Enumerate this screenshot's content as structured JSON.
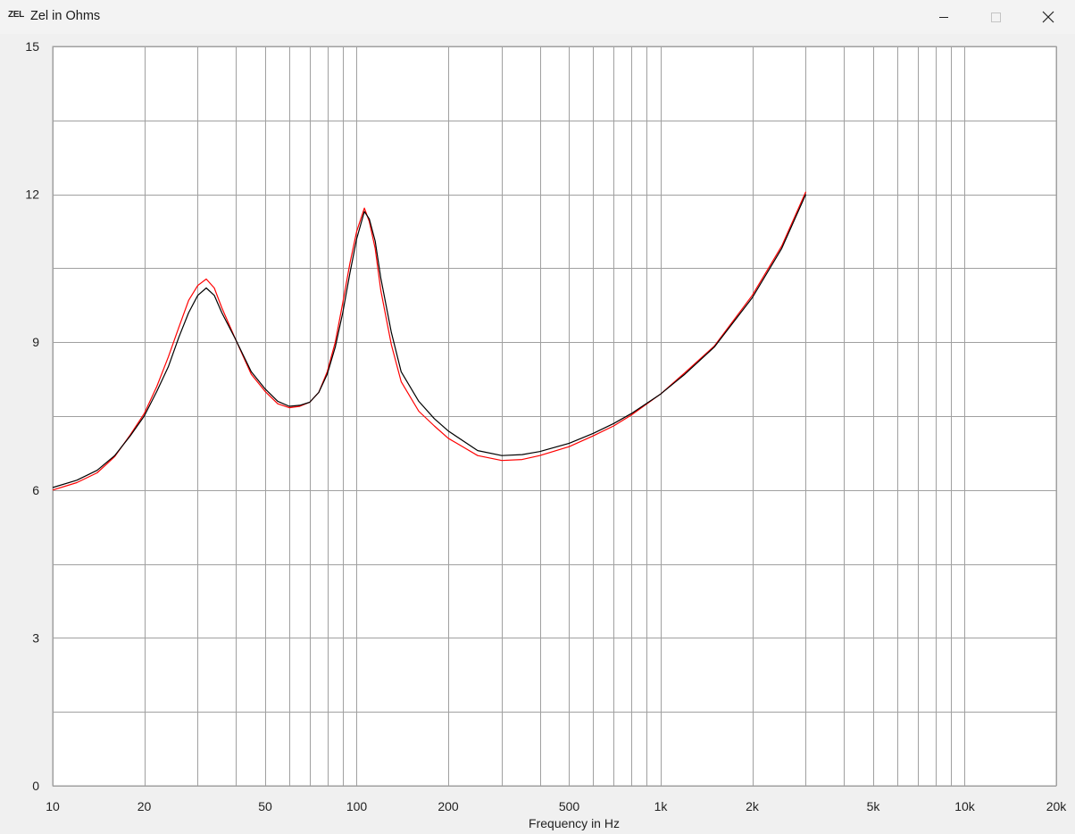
{
  "window": {
    "app_icon_text": "ZEL",
    "title": "Zel in Ohms",
    "minimize_icon": "minimize-icon",
    "maximize_icon": "maximize-icon",
    "close_icon": "close-icon"
  },
  "colors": {
    "background": "#f0f0f0",
    "plot_background": "#ffffff",
    "grid": "#a0a0a0",
    "series_measured": "#000000",
    "series_simulated": "#ff0000"
  },
  "chart_data": {
    "type": "line",
    "title": "",
    "xlabel": "Frequency in Hz",
    "ylabel": "",
    "x_scale": "log",
    "xlim": [
      10,
      20000
    ],
    "ylim": [
      0,
      15
    ],
    "grid": true,
    "x_tick_labels": [
      {
        "value": 10,
        "label": "10"
      },
      {
        "value": 20,
        "label": "20"
      },
      {
        "value": 50,
        "label": "50"
      },
      {
        "value": 100,
        "label": "100"
      },
      {
        "value": 200,
        "label": "200"
      },
      {
        "value": 500,
        "label": "500"
      },
      {
        "value": 1000,
        "label": "1k"
      },
      {
        "value": 2000,
        "label": "2k"
      },
      {
        "value": 5000,
        "label": "5k"
      },
      {
        "value": 10000,
        "label": "10k"
      },
      {
        "value": 20000,
        "label": "20k"
      }
    ],
    "y_tick_labels": [
      {
        "value": 0,
        "label": "0"
      },
      {
        "value": 3,
        "label": "3"
      },
      {
        "value": 6,
        "label": "6"
      },
      {
        "value": 9,
        "label": "9"
      },
      {
        "value": 12,
        "label": "12"
      },
      {
        "value": 15,
        "label": "15"
      }
    ],
    "y_minor_gridlines": [
      1.5,
      4.5,
      7.5,
      10.5,
      13.5
    ],
    "series": [
      {
        "color": "#000000",
        "points": [
          [
            10,
            6.05
          ],
          [
            12,
            6.2
          ],
          [
            14,
            6.4
          ],
          [
            16,
            6.7
          ],
          [
            18,
            7.1
          ],
          [
            20,
            7.5
          ],
          [
            22,
            8.0
          ],
          [
            24,
            8.5
          ],
          [
            26,
            9.1
          ],
          [
            28,
            9.6
          ],
          [
            30,
            9.95
          ],
          [
            32,
            10.1
          ],
          [
            34,
            9.95
          ],
          [
            36,
            9.6
          ],
          [
            40,
            9.05
          ],
          [
            45,
            8.4
          ],
          [
            50,
            8.05
          ],
          [
            55,
            7.8
          ],
          [
            60,
            7.7
          ],
          [
            65,
            7.72
          ],
          [
            70,
            7.78
          ],
          [
            75,
            7.98
          ],
          [
            80,
            8.35
          ],
          [
            85,
            8.9
          ],
          [
            90,
            9.6
          ],
          [
            95,
            10.4
          ],
          [
            100,
            11.1
          ],
          [
            106,
            11.65
          ],
          [
            110,
            11.5
          ],
          [
            115,
            11.05
          ],
          [
            120,
            10.3
          ],
          [
            130,
            9.2
          ],
          [
            140,
            8.4
          ],
          [
            160,
            7.8
          ],
          [
            180,
            7.45
          ],
          [
            200,
            7.2
          ],
          [
            250,
            6.8
          ],
          [
            300,
            6.7
          ],
          [
            350,
            6.72
          ],
          [
            400,
            6.78
          ],
          [
            500,
            6.95
          ],
          [
            600,
            7.15
          ],
          [
            700,
            7.35
          ],
          [
            800,
            7.55
          ],
          [
            1000,
            7.95
          ],
          [
            1200,
            8.35
          ],
          [
            1500,
            8.9
          ],
          [
            2000,
            9.9
          ],
          [
            2500,
            10.9
          ],
          [
            3000,
            12.0
          ]
        ]
      },
      {
        "color": "#ff0000",
        "points": [
          [
            10,
            6.0
          ],
          [
            12,
            6.15
          ],
          [
            14,
            6.35
          ],
          [
            16,
            6.68
          ],
          [
            18,
            7.12
          ],
          [
            20,
            7.55
          ],
          [
            22,
            8.1
          ],
          [
            24,
            8.7
          ],
          [
            26,
            9.3
          ],
          [
            28,
            9.85
          ],
          [
            30,
            10.15
          ],
          [
            32,
            10.28
          ],
          [
            34,
            10.1
          ],
          [
            36,
            9.7
          ],
          [
            40,
            9.05
          ],
          [
            45,
            8.35
          ],
          [
            50,
            8.0
          ],
          [
            55,
            7.75
          ],
          [
            60,
            7.67
          ],
          [
            65,
            7.7
          ],
          [
            70,
            7.78
          ],
          [
            75,
            7.98
          ],
          [
            80,
            8.4
          ],
          [
            85,
            9.0
          ],
          [
            90,
            9.8
          ],
          [
            95,
            10.6
          ],
          [
            100,
            11.25
          ],
          [
            106,
            11.72
          ],
          [
            110,
            11.45
          ],
          [
            115,
            10.9
          ],
          [
            120,
            10.05
          ],
          [
            130,
            8.95
          ],
          [
            140,
            8.2
          ],
          [
            160,
            7.6
          ],
          [
            180,
            7.3
          ],
          [
            200,
            7.05
          ],
          [
            250,
            6.7
          ],
          [
            300,
            6.6
          ],
          [
            350,
            6.62
          ],
          [
            400,
            6.7
          ],
          [
            500,
            6.88
          ],
          [
            600,
            7.1
          ],
          [
            700,
            7.3
          ],
          [
            800,
            7.52
          ],
          [
            1000,
            7.95
          ],
          [
            1200,
            8.38
          ],
          [
            1500,
            8.92
          ],
          [
            2000,
            9.95
          ],
          [
            2500,
            10.95
          ],
          [
            3000,
            12.05
          ]
        ]
      }
    ]
  }
}
